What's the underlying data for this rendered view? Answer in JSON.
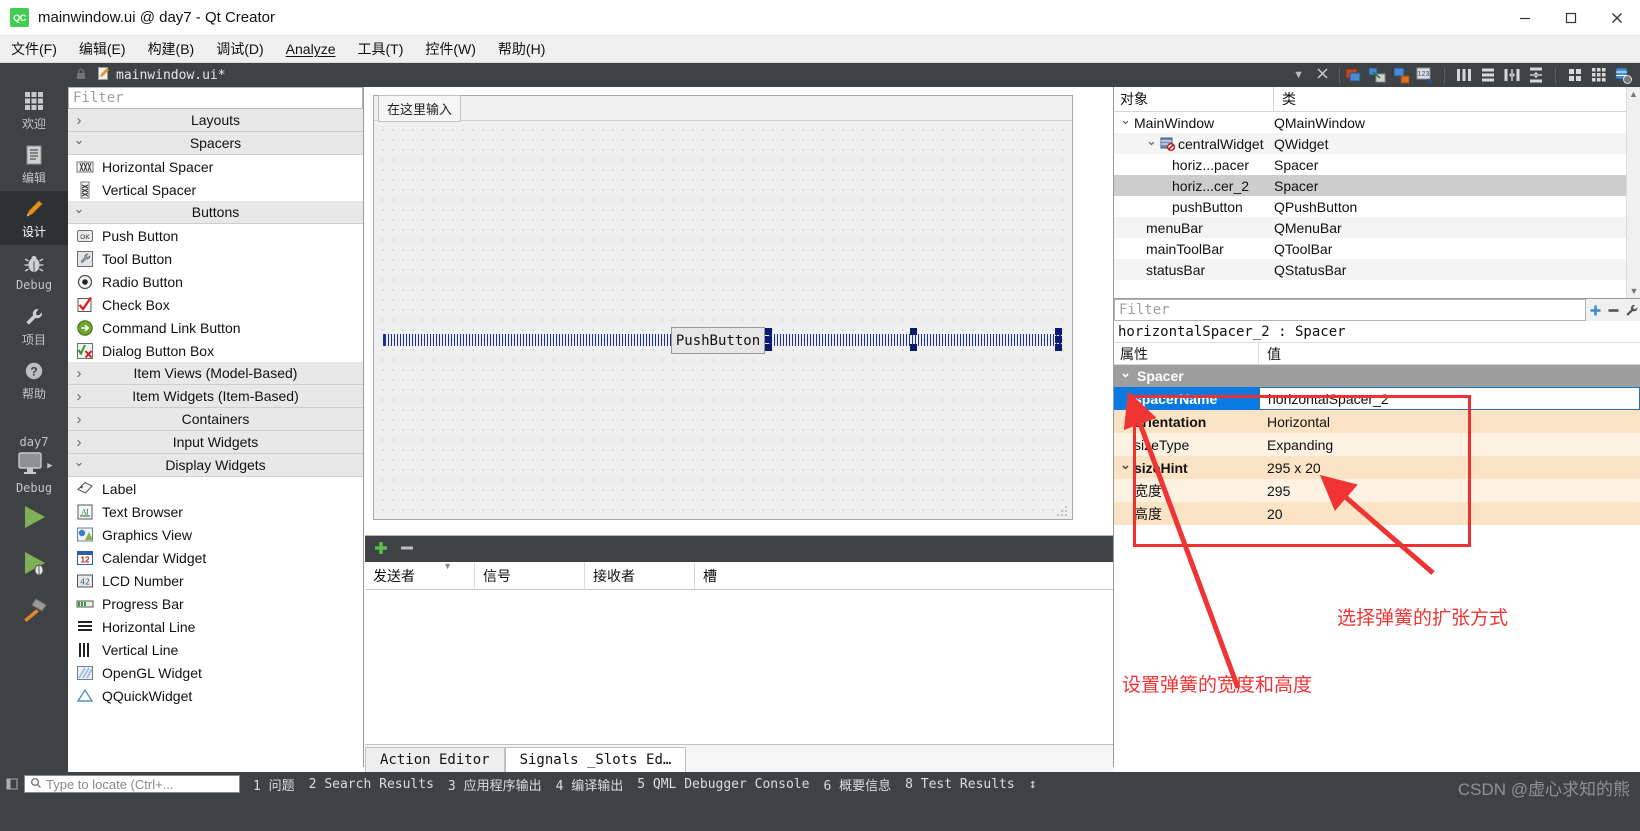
{
  "window": {
    "title": "mainwindow.ui @ day7 - Qt Creator",
    "logo_text": "QC",
    "minimize_label": "Minimize",
    "maximize_label": "Maximize",
    "close_label": "Close"
  },
  "menubar": {
    "items": [
      {
        "label": "文件(F)",
        "mnemonic": "F"
      },
      {
        "label": "编辑(E)",
        "mnemonic": "E"
      },
      {
        "label": "构建(B)",
        "mnemonic": "B"
      },
      {
        "label": "调试(D)",
        "mnemonic": "D"
      },
      {
        "label": "Analyze",
        "mnemonic": "A"
      },
      {
        "label": "工具(T)",
        "mnemonic": "T"
      },
      {
        "label": "控件(W)",
        "mnemonic": "W"
      },
      {
        "label": "帮助(H)",
        "mnemonic": "H"
      }
    ]
  },
  "modebar": {
    "modes": [
      {
        "label": "欢迎",
        "icon": "grid-icon",
        "active": false
      },
      {
        "label": "编辑",
        "icon": "document-icon",
        "active": false
      },
      {
        "label": "设计",
        "icon": "pencil-icon",
        "active": true
      },
      {
        "label": "Debug",
        "icon": "bug-icon",
        "active": false
      },
      {
        "label": "项目",
        "icon": "wrench-icon",
        "active": false
      },
      {
        "label": "帮助",
        "icon": "question-icon",
        "active": false
      }
    ],
    "kit": {
      "project": "day7",
      "config": "Debug",
      "icon": "monitor-icon"
    },
    "run_buttons": [
      {
        "name": "run-button",
        "icon": "play-icon"
      },
      {
        "name": "debug-button",
        "icon": "play-bug-icon"
      },
      {
        "name": "build-button",
        "icon": "hammer-icon"
      }
    ]
  },
  "tabstrip": {
    "filename": "mainwindow.ui*",
    "lock_icon": "lock-icon",
    "dropdown_icon": "chevron-down-icon",
    "close_icon": "close-icon",
    "tools": [
      "edit-widgets-icon",
      "edit-signals-slots-icon",
      "edit-buddies-icon",
      "edit-tab-order-icon",
      "layout-horizontal-icon",
      "layout-vertical-icon",
      "layout-splitter-h-icon",
      "layout-splitter-v-icon",
      "layout-grid-icon",
      "layout-form-icon",
      "break-layout-icon"
    ]
  },
  "widgetbox": {
    "filter_placeholder": "Filter",
    "groups": [
      {
        "name": "Layouts",
        "expanded": false,
        "items": []
      },
      {
        "name": "Spacers",
        "expanded": true,
        "items": [
          {
            "label": "Horizontal Spacer",
            "icon": "horizontal-spacer-icon"
          },
          {
            "label": "Vertical Spacer",
            "icon": "vertical-spacer-icon"
          }
        ]
      },
      {
        "name": "Buttons",
        "expanded": true,
        "items": [
          {
            "label": "Push Button",
            "icon": "push-button-icon"
          },
          {
            "label": "Tool Button",
            "icon": "tool-button-icon"
          },
          {
            "label": "Radio Button",
            "icon": "radio-button-icon"
          },
          {
            "label": "Check Box",
            "icon": "check-box-icon"
          },
          {
            "label": "Command Link Button",
            "icon": "command-link-icon"
          },
          {
            "label": "Dialog Button Box",
            "icon": "dialog-button-box-icon"
          }
        ]
      },
      {
        "name": "Item Views (Model-Based)",
        "expanded": false,
        "items": []
      },
      {
        "name": "Item Widgets (Item-Based)",
        "expanded": false,
        "items": []
      },
      {
        "name": "Containers",
        "expanded": false,
        "items": []
      },
      {
        "name": "Input Widgets",
        "expanded": false,
        "items": []
      },
      {
        "name": "Display Widgets",
        "expanded": true,
        "items": [
          {
            "label": "Label",
            "icon": "label-icon"
          },
          {
            "label": "Text Browser",
            "icon": "text-browser-icon"
          },
          {
            "label": "Graphics View",
            "icon": "graphics-view-icon"
          },
          {
            "label": "Calendar Widget",
            "icon": "calendar-icon"
          },
          {
            "label": "LCD Number",
            "icon": "lcd-number-icon"
          },
          {
            "label": "Progress Bar",
            "icon": "progress-bar-icon"
          },
          {
            "label": "Horizontal Line",
            "icon": "horizontal-line-icon"
          },
          {
            "label": "Vertical Line",
            "icon": "vertical-line-icon"
          },
          {
            "label": "OpenGL Widget",
            "icon": "opengl-widget-icon"
          },
          {
            "label": "QQuickWidget",
            "icon": "qquickwidget-icon"
          }
        ]
      }
    ]
  },
  "form": {
    "menu_placeholder": "在这里输入",
    "pushbutton_label": "PushButton",
    "selected_widget": "horizontalSpacer_2"
  },
  "signal_slot_editor": {
    "add_label": "+",
    "remove_label": "−",
    "columns": [
      "发送者",
      "信号",
      "接收者",
      "槽"
    ],
    "rows": []
  },
  "bottom_tabs": {
    "tabs": [
      {
        "label": "Action Editor",
        "active": false
      },
      {
        "label": "Signals _Slots Ed…",
        "active": true
      }
    ]
  },
  "object_tree": {
    "columns": [
      "对象",
      "类"
    ],
    "rows": [
      {
        "name": "MainWindow",
        "class": "QMainWindow",
        "indent": 0,
        "twisty": "down",
        "icon": "",
        "selected": false
      },
      {
        "name": "centralWidget",
        "class": "QWidget",
        "indent": 1,
        "twisty": "down",
        "icon": "no-layout-icon",
        "selected": false
      },
      {
        "name": "horiz...pacer",
        "class": "Spacer",
        "indent": 2,
        "twisty": "",
        "icon": "",
        "selected": false
      },
      {
        "name": "horiz...cer_2",
        "class": "Spacer",
        "indent": 2,
        "twisty": "",
        "icon": "",
        "selected": true
      },
      {
        "name": "pushButton",
        "class": "QPushButton",
        "indent": 2,
        "twisty": "",
        "icon": "",
        "selected": false
      },
      {
        "name": "menuBar",
        "class": "QMenuBar",
        "indent": 1,
        "twisty": "",
        "icon": "",
        "selected": false
      },
      {
        "name": "mainToolBar",
        "class": "QToolBar",
        "indent": 1,
        "twisty": "",
        "icon": "",
        "selected": false
      },
      {
        "name": "statusBar",
        "class": "QStatusBar",
        "indent": 1,
        "twisty": "",
        "icon": "",
        "selected": false
      }
    ]
  },
  "property_editor": {
    "filter_placeholder": "Filter",
    "object_line": "horizontalSpacer_2 : Spacer",
    "columns": [
      "属性",
      "值"
    ],
    "group_label": "Spacer",
    "add_icon": "add-icon",
    "remove_icon": "remove-icon",
    "config_icon": "configure-icon",
    "rows": [
      {
        "key": "spacerName",
        "value": "horizontalSpacer_2",
        "selected": true,
        "bold": true,
        "twisty": ""
      },
      {
        "key": "orientation",
        "value": "Horizontal",
        "selected": false,
        "bold": true,
        "twisty": ""
      },
      {
        "key": "sizeType",
        "value": "Expanding",
        "selected": false,
        "bold": false,
        "twisty": ""
      },
      {
        "key": "sizeHint",
        "value": "295 x 20",
        "selected": false,
        "bold": true,
        "twisty": "down"
      },
      {
        "key": "宽度",
        "value": "295",
        "selected": false,
        "bold": false,
        "twisty": ""
      },
      {
        "key": "高度",
        "value": "20",
        "selected": false,
        "bold": false,
        "twisty": ""
      }
    ]
  },
  "annotations": {
    "color": "#f03434",
    "size_note": "设置弹簧的宽度和高度",
    "expand_note": "选择弹簧的扩张方式"
  },
  "statusbar": {
    "locator_placeholder": "Type to locate (Ctrl+...",
    "locator_icon": "search-icon",
    "outputs": [
      {
        "num": "1",
        "label": "问题"
      },
      {
        "num": "2",
        "label": "Search Results"
      },
      {
        "num": "3",
        "label": "应用程序输出"
      },
      {
        "num": "4",
        "label": "编译输出"
      },
      {
        "num": "5",
        "label": "QML Debugger Console"
      },
      {
        "num": "6",
        "label": "概要信息"
      },
      {
        "num": "8",
        "label": "Test Results"
      }
    ],
    "updown_icon": "up-down-icon",
    "watermark": "CSDN @虚心求知的熊"
  }
}
